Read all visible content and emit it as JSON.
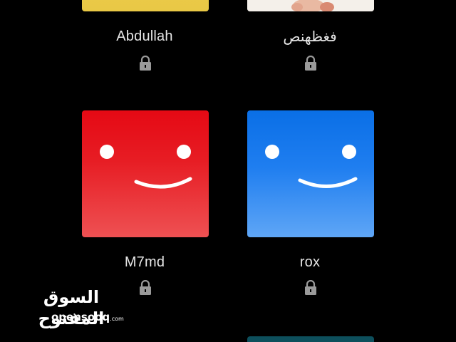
{
  "profiles": [
    {
      "name": "Abdullah",
      "avatar": "yellow-avatar",
      "locked": true
    },
    {
      "name": "فغظهنص",
      "avatar": "photo-avatar",
      "locked": true
    },
    {
      "name": "M7md",
      "avatar": "red-smile-avatar",
      "color": "#e50914",
      "locked": true
    },
    {
      "name": "rox",
      "avatar": "blue-smile-avatar",
      "color": "#0a6fe6",
      "locked": true
    }
  ],
  "watermark": {
    "arabic": "السوق المفتوح",
    "latin": "opensooq",
    "suffix": ".com"
  },
  "colors": {
    "background": "#000000",
    "text": "#e6e6e6",
    "lock": "#9a9a9a"
  }
}
